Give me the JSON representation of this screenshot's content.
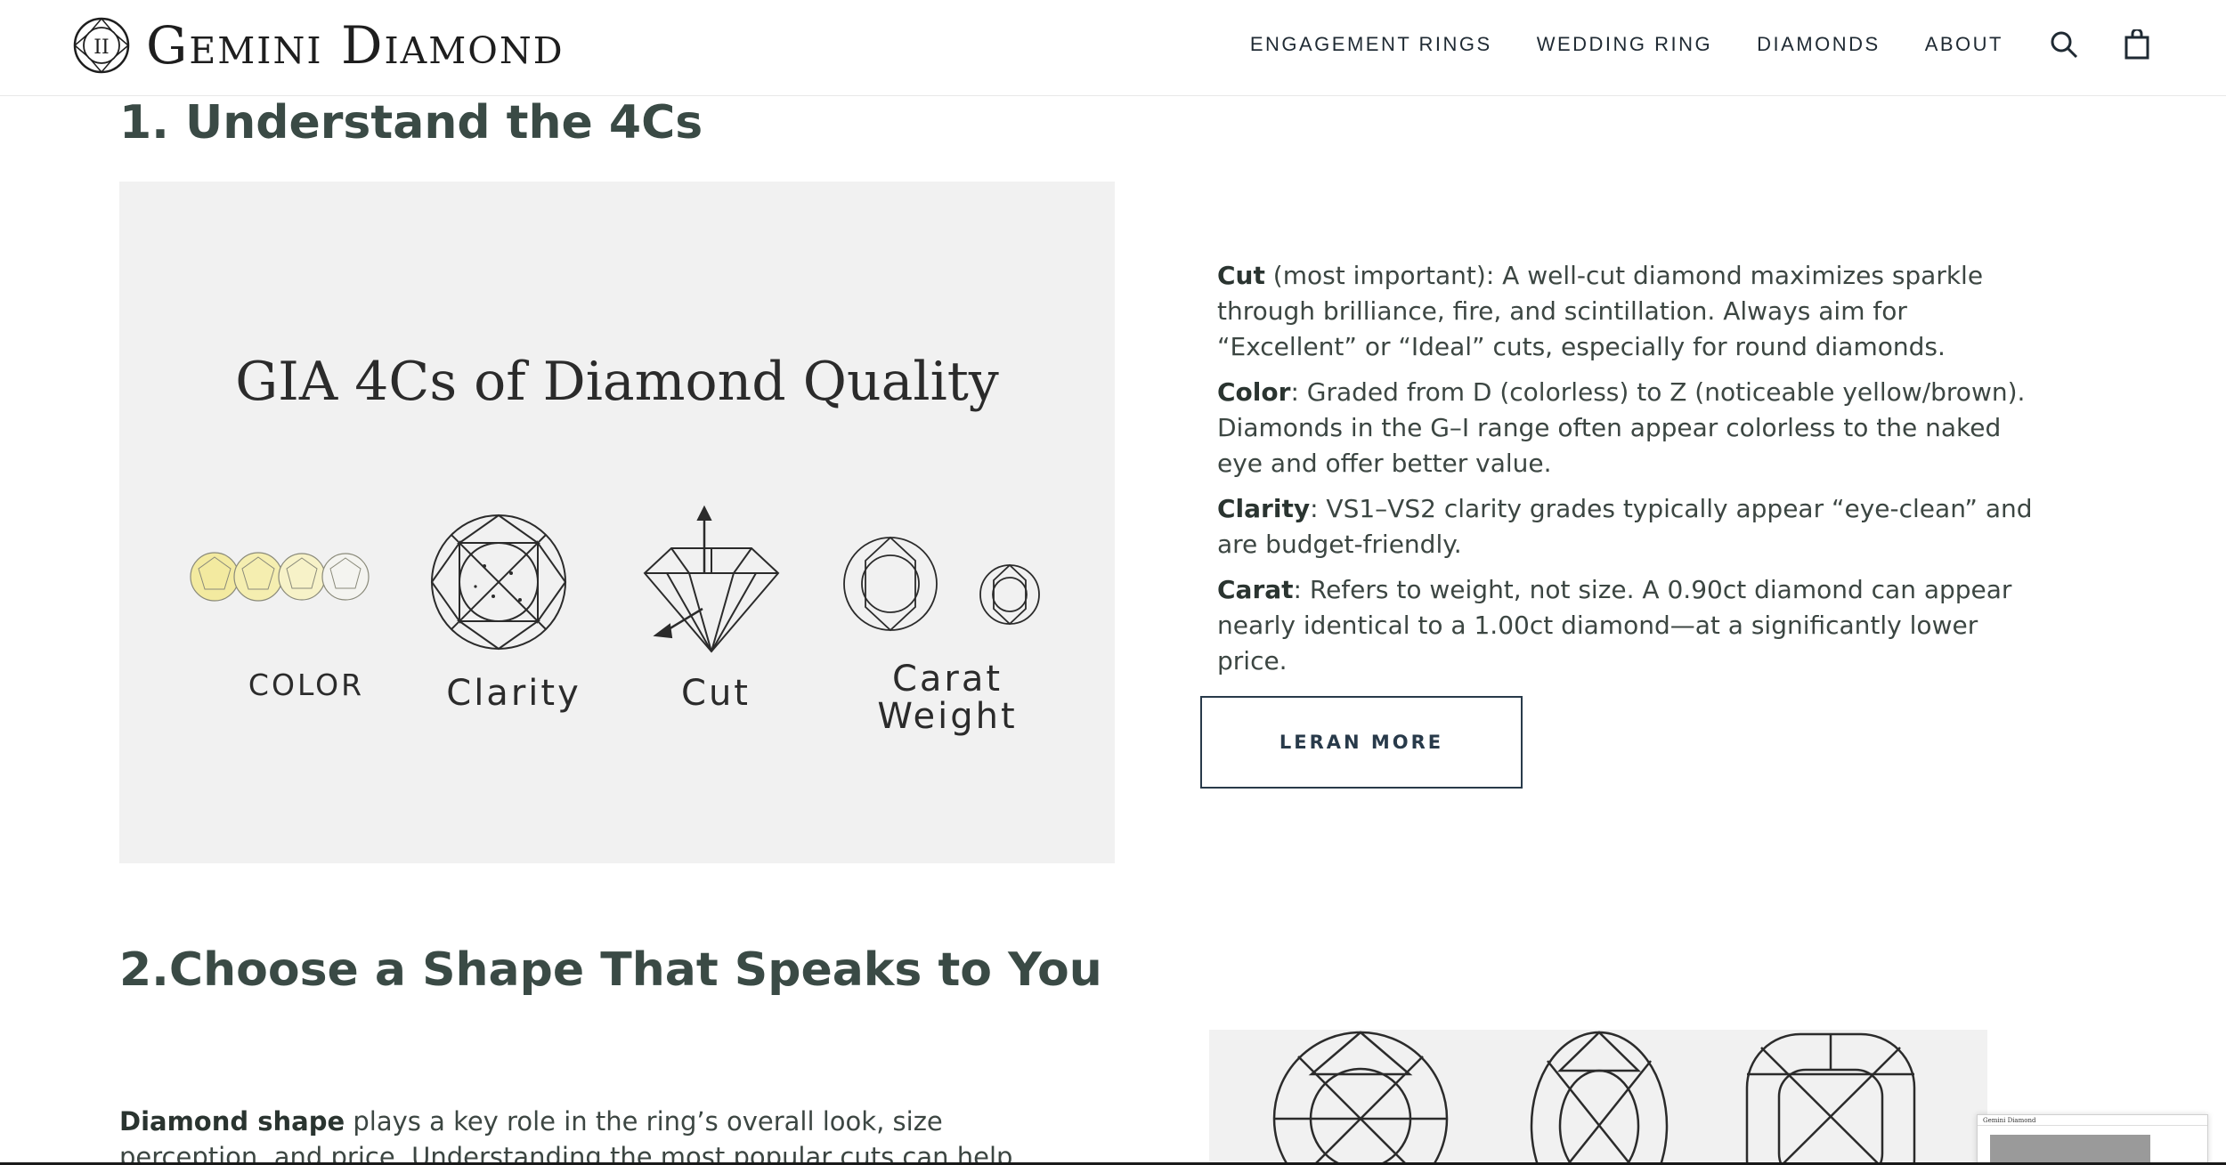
{
  "header": {
    "brand": "Gemini Diamond",
    "nav": [
      "ENGAGEMENT RINGS",
      "WEDDING RING",
      "DIAMONDS",
      "ABOUT"
    ],
    "icons": [
      "search-icon",
      "shopping-bag-icon"
    ]
  },
  "section1": {
    "title": "1. Understand the 4Cs",
    "image": {
      "title": "GIA 4Cs of Diamond Quality",
      "captions": {
        "color": "COLOR",
        "clarity": "Clarity",
        "cut": "Cut",
        "carat_line1": "Carat",
        "carat_line2": "Weight"
      }
    },
    "items": [
      {
        "term": "Cut",
        "text": " (most important): A well-cut diamond maximizes sparkle through brilliance, fire, and scintillation. Always aim for “Excellent” or “Ideal” cuts, especially for round diamonds."
      },
      {
        "term": "Color",
        "text": ": Graded from D (colorless) to Z (noticeable yellow/brown). Diamonds in the G–I range often appear colorless to the naked eye and offer better value."
      },
      {
        "term": "Clarity",
        "text": ": VS1–VS2 clarity grades typically appear “eye-clean” and are budget-friendly."
      },
      {
        "term": "Carat",
        "text": ": Refers to weight, not size. A 0.90ct diamond can appear nearly identical to a 1.00ct diamond—at a significantly lower price."
      }
    ],
    "button": "LERAN MORE"
  },
  "section2": {
    "title": "2.Choose a Shape That Speaks to You",
    "intro_term": "Diamond shape",
    "intro_text": " plays a key role in the ring’s overall look, size perception, and price. Understanding the most popular cuts can help you make a confident"
  },
  "thumbnail": {
    "label": "Gemini Diamond"
  },
  "colors": {
    "accent": "#283a4a",
    "heading": "#3a4a45",
    "panel_bg": "#f1f1f1",
    "yellow_diamond": "#f3eaa0"
  }
}
